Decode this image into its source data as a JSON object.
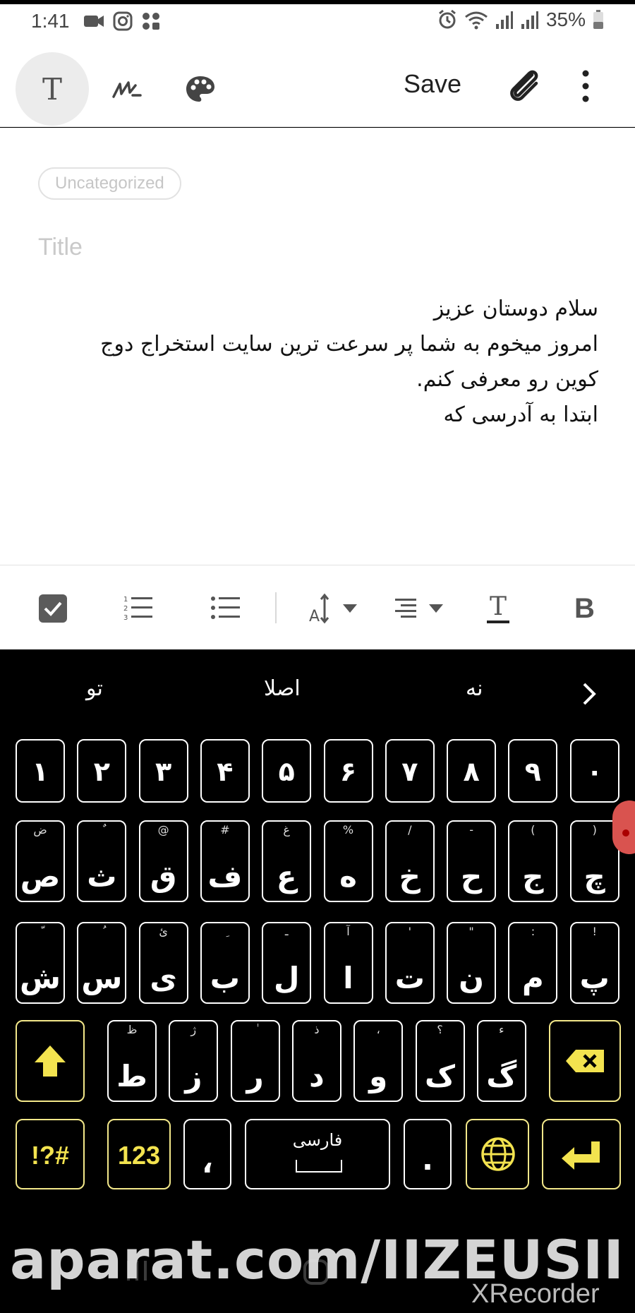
{
  "status_bar": {
    "time": "1:41",
    "battery": "35%",
    "icons_left": [
      "video-call-icon",
      "instagram-icon",
      "app-icon"
    ],
    "icons_right": [
      "alarm-icon",
      "wifi-icon",
      "signal-icon",
      "signal-icon-2",
      "battery-icon"
    ]
  },
  "toolbar": {
    "text_tool_glyph": "T",
    "save_label": "Save"
  },
  "note": {
    "category": "Uncategorized",
    "title_placeholder": "Title",
    "body_lines": [
      "سلام دوستان عزیز",
      "امروز میخوم به شما پر سرعت ترین سایت استخراج دوج",
      "کوین رو معرفی کنم.",
      "ابتدا به آدرسی که"
    ]
  },
  "format_bar": {
    "text_style_glyph": "T",
    "bold_glyph": "B",
    "items": [
      "checkbox-icon",
      "numbered-list-icon",
      "bulleted-list-icon",
      "font-size-icon",
      "align-icon",
      "text-style-icon",
      "bold-icon"
    ]
  },
  "keyboard": {
    "suggestions": [
      "تو",
      "اصلا",
      "نه"
    ],
    "row_numbers": [
      "۱",
      "۲",
      "۳",
      "۴",
      "۵",
      "۶",
      "۷",
      "۸",
      "۹",
      "۰"
    ],
    "row1": [
      {
        "main": "ص",
        "hint": "ض"
      },
      {
        "main": "ث",
        "hint": "ٌ"
      },
      {
        "main": "ق",
        "hint": "@"
      },
      {
        "main": "ف",
        "hint": "#"
      },
      {
        "main": "ع",
        "hint": "غ"
      },
      {
        "main": "ه",
        "hint": "%"
      },
      {
        "main": "خ",
        "hint": "/"
      },
      {
        "main": "ح",
        "hint": "-"
      },
      {
        "main": "ج",
        "hint": "("
      },
      {
        "main": "چ",
        "hint": ")"
      }
    ],
    "row2": [
      {
        "main": "ش",
        "hint": "ّ"
      },
      {
        "main": "س",
        "hint": "ُ"
      },
      {
        "main": "ی",
        "hint": "ئ"
      },
      {
        "main": "ب",
        "hint": "ِ"
      },
      {
        "main": "ل",
        "hint": "ـ"
      },
      {
        "main": "ا",
        "hint": "آ"
      },
      {
        "main": "ت",
        "hint": "'"
      },
      {
        "main": "ن",
        "hint": "\""
      },
      {
        "main": "م",
        "hint": ":"
      },
      {
        "main": "پ",
        "hint": "!"
      }
    ],
    "row3": [
      {
        "main": "ط",
        "hint": "ظ"
      },
      {
        "main": "ز",
        "hint": "ژ"
      },
      {
        "main": "ر",
        "hint": "ٰ"
      },
      {
        "main": "د",
        "hint": "ذ"
      },
      {
        "main": "و",
        "hint": "،"
      },
      {
        "main": "ک",
        "hint": "؟"
      },
      {
        "main": "گ",
        "hint": "ء"
      }
    ],
    "symbols_label": "!?#",
    "numbers_label": "123",
    "comma": "،",
    "space_label": "فارسی",
    "period": ".",
    "shift_icon": "shift-arrow-icon",
    "backspace_icon": "backspace-icon",
    "globe_icon": "globe-icon",
    "enter_icon": "enter-icon"
  },
  "watermark": {
    "site": "aparat.com/IIZEUSII",
    "recorder": "XRecorder"
  }
}
